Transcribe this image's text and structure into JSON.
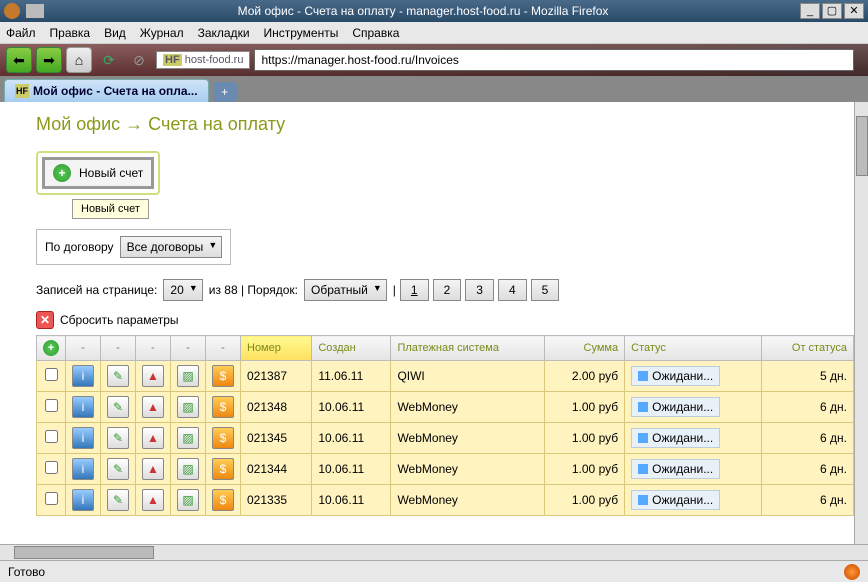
{
  "window": {
    "title": "Мой офис - Счета на оплату - manager.host-food.ru - Mozilla Firefox",
    "min": "_",
    "max": "▢",
    "close": "✕"
  },
  "menu": [
    "Файл",
    "Правка",
    "Вид",
    "Журнал",
    "Закладки",
    "Инструменты",
    "Справка"
  ],
  "urlbar": {
    "site_label": "host-food.ru",
    "url": "https://manager.host-food.ru/Invoices"
  },
  "tab": {
    "title": "Мой офис - Счета на опла...",
    "fav": "HF"
  },
  "breadcrumb": {
    "a": "Мой офис",
    "arrow": "→",
    "b": "Счета на оплату"
  },
  "new_invoice_btn": "Новый счет",
  "tooltip": "Новый счет",
  "filter": {
    "label": "По договору",
    "value": "Все договоры"
  },
  "paging": {
    "records_label": "Записей на странице:",
    "per_page": "20",
    "of_total": "из 88 | Порядок:",
    "order": "Обратный",
    "pages": [
      "1",
      "2",
      "3",
      "4",
      "5"
    ]
  },
  "reset_label": "Сбросить параметры",
  "columns": {
    "number": "Номер",
    "created": "Создан",
    "payment": "Платежная система",
    "sum": "Сумма",
    "status": "Статус",
    "since": "От статуса"
  },
  "currency": "руб",
  "status_text": "Ожидани...",
  "rows": [
    {
      "number": "021387",
      "created": "11.06.11",
      "payment": "QIWI",
      "sum": "2.00",
      "since": "5 дн."
    },
    {
      "number": "021348",
      "created": "10.06.11",
      "payment": "WebMoney",
      "sum": "1.00",
      "since": "6 дн."
    },
    {
      "number": "021345",
      "created": "10.06.11",
      "payment": "WebMoney",
      "sum": "1.00",
      "since": "6 дн."
    },
    {
      "number": "021344",
      "created": "10.06.11",
      "payment": "WebMoney",
      "sum": "1.00",
      "since": "6 дн."
    },
    {
      "number": "021335",
      "created": "10.06.11",
      "payment": "WebMoney",
      "sum": "1.00",
      "since": "6 дн."
    }
  ],
  "statusbar": "Готово"
}
